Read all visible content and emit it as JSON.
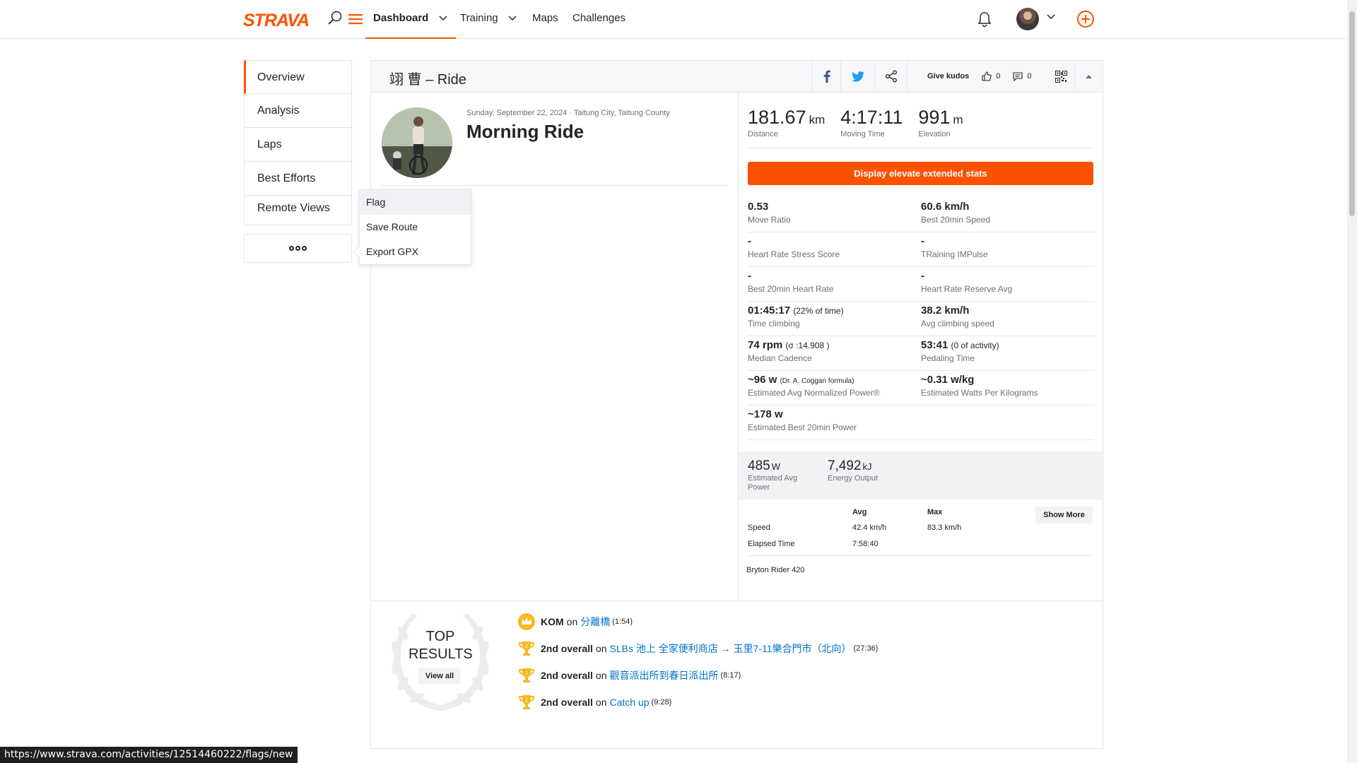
{
  "nav": {
    "logo": "STRAVA",
    "dashboard": "Dashboard",
    "training": "Training",
    "maps": "Maps",
    "challenges": "Challenges",
    "accent": "#fc5200"
  },
  "sidebar": {
    "items": [
      "Overview",
      "Analysis",
      "Laps",
      "Best Efforts",
      "Remote Views"
    ],
    "more_icon": "ooo"
  },
  "dropdown": {
    "items": [
      "Flag",
      "Save Route",
      "Export GPX"
    ]
  },
  "header": {
    "title": "翊 曹 – Ride",
    "give_kudos": "Give kudos",
    "kudos_count": "0",
    "comment_count": "0"
  },
  "activity": {
    "date_location": "Sunday, September 22, 2024 · Taitung City, Taitung County",
    "name": "Morning Ride"
  },
  "stats": {
    "distance": {
      "value": "181.67",
      "unit": "km",
      "label": "Distance"
    },
    "moving_time": {
      "value": "4:17:11",
      "label": "Moving Time"
    },
    "elevation": {
      "value": "991",
      "unit": "m",
      "label": "Elevation"
    },
    "elevate_button": "Display elevate extended stats",
    "grid": [
      [
        {
          "v": "0.53",
          "sub": "",
          "l": "Move Ratio"
        },
        {
          "v": "60.6 km/h",
          "sub": "",
          "l": "Best 20min Speed"
        }
      ],
      [
        {
          "v": "-",
          "sub": "",
          "l": "Heart Rate Stress Score"
        },
        {
          "v": "-",
          "sub": "",
          "l": "TRaining IMPulse"
        }
      ],
      [
        {
          "v": "-",
          "sub": "",
          "l": "Best 20min Heart Rate"
        },
        {
          "v": "-",
          "sub": "",
          "l": "Heart Rate Reserve Avg"
        }
      ],
      [
        {
          "v": "01:45:17",
          "sub": "(22% of time)",
          "l": "Time climbing"
        },
        {
          "v": "38.2 km/h",
          "sub": "",
          "l": "Avg climbing speed"
        }
      ],
      [
        {
          "v": "74 rpm",
          "sub": "(σ :14.908 )",
          "l": "Median Cadence"
        },
        {
          "v": "53:41",
          "sub": "(0 of activity)",
          "l": "Pedaling Time"
        }
      ],
      [
        {
          "v": "~96 w",
          "tiny": "(Dr. A. Coggan formula)",
          "l": "Estimated Avg Normalized Power®"
        },
        {
          "v": "~0.31 w/kg",
          "sub": "",
          "l": "Estimated Watts Per Kilograms"
        }
      ],
      [
        {
          "v": "~178 w",
          "sub": "",
          "l": "Estimated Best 20min Power"
        },
        {
          "v": "",
          "sub": "",
          "l": ""
        }
      ]
    ],
    "avg_power": {
      "value": "485",
      "unit": "W",
      "label": "Estimated Avg Power"
    },
    "energy": {
      "value": "7,492",
      "unit": "kJ",
      "label": "Energy Output"
    },
    "table": {
      "avg_header": "Avg",
      "max_header": "Max",
      "show_more": "Show More",
      "speed_label": "Speed",
      "speed_avg": "42.4 km/h",
      "speed_max": "83.3 km/h",
      "elapsed_label": "Elapsed Time",
      "elapsed_avg": "7:58:40"
    },
    "device": "Bryton Rider 420"
  },
  "top_results": {
    "title_line1": "TOP",
    "title_line2": "RESULTS",
    "view_all": "View all",
    "on": "on",
    "items": [
      {
        "rank": "KOM",
        "segment": "分離橋",
        "time": "(1:54)",
        "icon": "crown-icon"
      },
      {
        "rank": "2nd overall",
        "segment": "SLBs 池上 全家便利商店 → 玉里7-11樂合門市（北向）",
        "time": "(27:36)",
        "icon": "trophy-icon"
      },
      {
        "rank": "2nd overall",
        "segment": "觀音派出所到春日派出所",
        "time": "(8:17)",
        "icon": "trophy-icon"
      },
      {
        "rank": "2nd overall",
        "segment": "Catch up",
        "time": "(9:28)",
        "icon": "trophy-icon"
      }
    ]
  },
  "statusbar": {
    "url": "https://www.strava.com/activities/12514460222/flags/new"
  }
}
